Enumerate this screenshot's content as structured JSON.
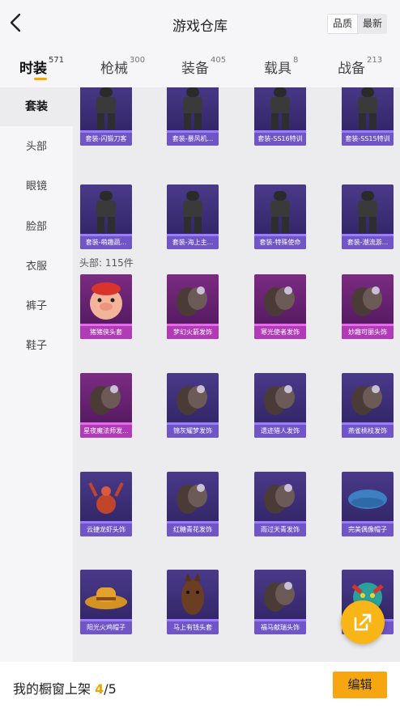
{
  "header": {
    "title": "游戏仓库",
    "sort_options": [
      "品质",
      "最新"
    ],
    "sort_selected": "品质"
  },
  "tabs": [
    {
      "label": "时装",
      "count": "571",
      "active": true
    },
    {
      "label": "枪械",
      "count": "300",
      "active": false
    },
    {
      "label": "装备",
      "count": "405",
      "active": false
    },
    {
      "label": "载具",
      "count": "8",
      "active": false
    },
    {
      "label": "战备",
      "count": "213",
      "active": false
    }
  ],
  "sidebar": {
    "items": [
      "套装",
      "头部",
      "眼镜",
      "脸部",
      "衣服",
      "裤子",
      "鞋子"
    ],
    "active": "套装"
  },
  "sections": {
    "head_label": "头部: 115件"
  },
  "suits": [
    {
      "name": "套装-闪锻刀客",
      "rarity": "violet",
      "icon": "suit-figure-icon"
    },
    {
      "name": "套装-暴风机...",
      "rarity": "violet",
      "icon": "suit-figure-icon"
    },
    {
      "name": "套装-SS16特训",
      "rarity": "violet",
      "icon": "suit-figure-icon"
    },
    {
      "name": "套装-SS15特训",
      "rarity": "violet",
      "icon": "suit-figure-icon"
    },
    {
      "name": "套装-萌趣蔬...",
      "rarity": "violet",
      "icon": "suit-figure-icon"
    },
    {
      "name": "套装-海上主...",
      "rarity": "violet",
      "icon": "suit-figure-icon"
    },
    {
      "name": "套装-特殊使命",
      "rarity": "violet",
      "icon": "suit-figure-icon"
    },
    {
      "name": "套装-潮流游...",
      "rarity": "violet",
      "icon": "suit-figure-icon"
    }
  ],
  "head_items": [
    {
      "name": "猪猪侠头套",
      "rarity": "pink",
      "icon": "pig-mask-icon"
    },
    {
      "name": "梦幻火箭发饰",
      "rarity": "pink",
      "icon": "hair-accessory-icon"
    },
    {
      "name": "寒光使者发饰",
      "rarity": "pink",
      "icon": "hair-accessory-icon"
    },
    {
      "name": "妙趣可丽头饰",
      "rarity": "pink",
      "icon": "hair-accessory-icon"
    },
    {
      "name": "星夜魔法师发...",
      "rarity": "pink",
      "icon": "hair-accessory-icon"
    },
    {
      "name": "锦灰耀梦发饰",
      "rarity": "violet",
      "icon": "hair-accessory-icon"
    },
    {
      "name": "遗迹猎人发饰",
      "rarity": "violet",
      "icon": "hair-accessory-icon"
    },
    {
      "name": "燕雀桃枝发饰",
      "rarity": "violet",
      "icon": "hair-accessory-icon"
    },
    {
      "name": "云捷龙虾头饰",
      "rarity": "violet",
      "icon": "lobster-hat-icon"
    },
    {
      "name": "红糖青花发饰",
      "rarity": "violet",
      "icon": "hair-accessory-icon"
    },
    {
      "name": "雨过天青发饰",
      "rarity": "violet",
      "icon": "hair-accessory-icon"
    },
    {
      "name": "完美偶像帽子",
      "rarity": "violet",
      "icon": "beret-icon"
    },
    {
      "name": "阳光火鸡帽子",
      "rarity": "violet",
      "icon": "cowboy-hat-icon"
    },
    {
      "name": "马上有钱头套",
      "rarity": "violet",
      "icon": "horse-mask-icon"
    },
    {
      "name": "福马献瑞头饰",
      "rarity": "violet",
      "icon": "hair-accessory-icon"
    },
    {
      "name": "",
      "rarity": "violet",
      "icon": "dragon-mask-icon"
    }
  ],
  "footer": {
    "label": "我的橱窗上架",
    "count": "4",
    "total": "/5",
    "edit_label": "编辑"
  },
  "colors": {
    "accent": "#f5a611",
    "violet": "#6f55c6",
    "pink": "#b13bb6"
  }
}
